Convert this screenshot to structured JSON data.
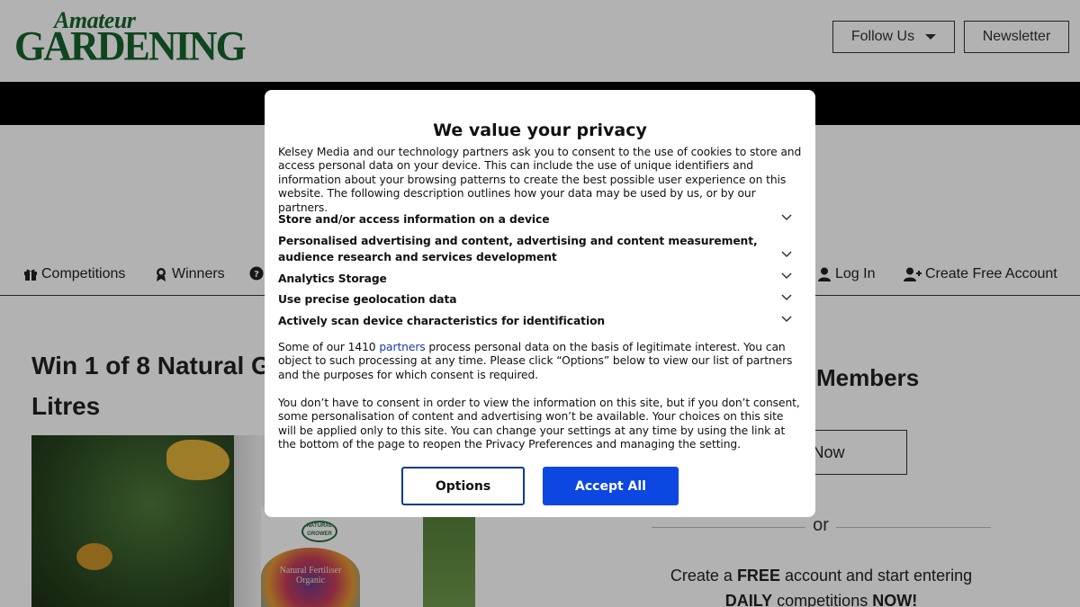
{
  "header": {
    "logo_line1": "Amateur",
    "logo_line2": "GARDENING",
    "follow_label": "Follow Us",
    "newsletter_label": "Newsletter"
  },
  "nav": {
    "competitions": "Competitions",
    "winners": "Winners",
    "login": "Log In",
    "create_account": "Create Free Account"
  },
  "article": {
    "title_line1": "Win 1 of 8 Natural G",
    "title_line2": "Litres",
    "image_seal": "NATURAL GROWER",
    "image_badge": "Natural Fertiliser Organic"
  },
  "sidebar": {
    "members_title": "Members",
    "join_label": "n Now",
    "or_text": "or",
    "promo_pre": "Create a ",
    "promo_free": "FREE",
    "promo_mid": " account and start entering",
    "promo_daily": "DAILY",
    "promo_post": " competitions ",
    "promo_now": "NOW!"
  },
  "consent": {
    "title": "We value your privacy",
    "intro": "Kelsey Media and our technology partners ask you to consent to the use of cookies to store and access personal data on your device. This can include the use of unique identifiers and information about your browsing patterns to create the best possible user experience on this website. The following description outlines how your data may be used by us, or by our partners.",
    "purposes": [
      {
        "label": "Store and/or access information on a device"
      },
      {
        "label": "Personalised advertising and content, advertising and content measurement, audience research and services development"
      },
      {
        "label": "Analytics Storage"
      },
      {
        "label": "Use precise geolocation data"
      },
      {
        "label": "Actively scan device characteristics for identification"
      }
    ],
    "legit_pre": "Some of our 1410 ",
    "legit_link": "partners",
    "legit_post": " process personal data on the basis of legitimate interest. You can object to such processing at any time. Please click “Options” below to view our list of partners and the purposes for which consent is required.",
    "no_consent": "You don’t have to consent in order to view the information on this site, but if you don’t consent, some personalisation of content and advertising won’t be available. Your choices on this site will be applied only to this site. You can change your settings at any time by using the link at the bottom of the page to reopen the Privacy Preferences and managing the setting.",
    "options_label": "Options",
    "accept_label": "Accept All"
  },
  "colors": {
    "brand_green": "#16632b",
    "accept_blue": "#0d47e2",
    "options_border": "#0b3a8f",
    "link_blue": "#1b3aa8"
  }
}
